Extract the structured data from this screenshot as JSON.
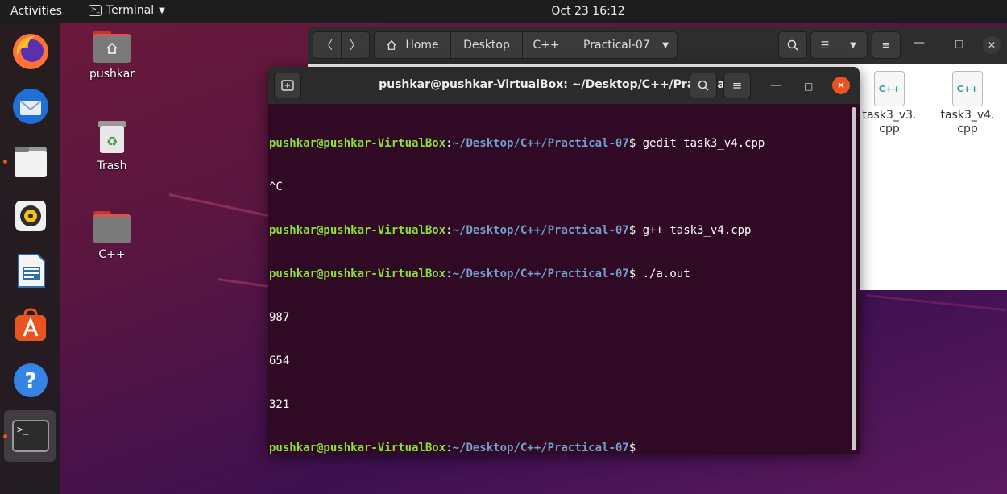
{
  "topbar": {
    "activities": "Activities",
    "app_name": "Terminal",
    "clock": "Oct 23  16:12"
  },
  "dock": {
    "items": [
      {
        "name": "firefox-icon"
      },
      {
        "name": "thunderbird-icon"
      },
      {
        "name": "files-icon"
      },
      {
        "name": "rhythmbox-icon"
      },
      {
        "name": "libreoffice-writer-icon"
      },
      {
        "name": "software-icon"
      },
      {
        "name": "help-icon"
      },
      {
        "name": "terminal-icon"
      }
    ]
  },
  "desktop": {
    "icons": [
      {
        "label": "pushkar"
      },
      {
        "label": "Trash"
      },
      {
        "label": "C++"
      }
    ]
  },
  "file_manager": {
    "breadcrumbs": [
      "Home",
      "Desktop",
      "C++",
      "Practical-07"
    ],
    "files": [
      {
        "icon_text": "C++",
        "name_line1": "task3_v3.",
        "name_line2": "cpp"
      },
      {
        "icon_text": "C++",
        "name_line1": "task3_v4.",
        "name_line2": "cpp"
      }
    ]
  },
  "terminal": {
    "title": "pushkar@pushkar-VirtualBox: ~/Desktop/C++/Practical-07",
    "prompt_user": "pushkar@pushkar-VirtualBox",
    "prompt_path": "~/Desktop/C++/Practical-07",
    "lines": [
      {
        "prompt": true,
        "cmd": " gedit task3_v4.cpp"
      },
      {
        "prompt": false,
        "text": "^C"
      },
      {
        "prompt": true,
        "cmd": " g++ task3_v4.cpp"
      },
      {
        "prompt": true,
        "cmd": " ./a.out"
      },
      {
        "prompt": false,
        "text": "987"
      },
      {
        "prompt": false,
        "text": "654"
      },
      {
        "prompt": false,
        "text": "321"
      },
      {
        "prompt": true,
        "cmd": ""
      }
    ]
  },
  "colors": {
    "accent": "#e95420",
    "prompt_user": "#8ae234",
    "prompt_path": "#729fcf",
    "terminal_bg": "#300a24"
  }
}
